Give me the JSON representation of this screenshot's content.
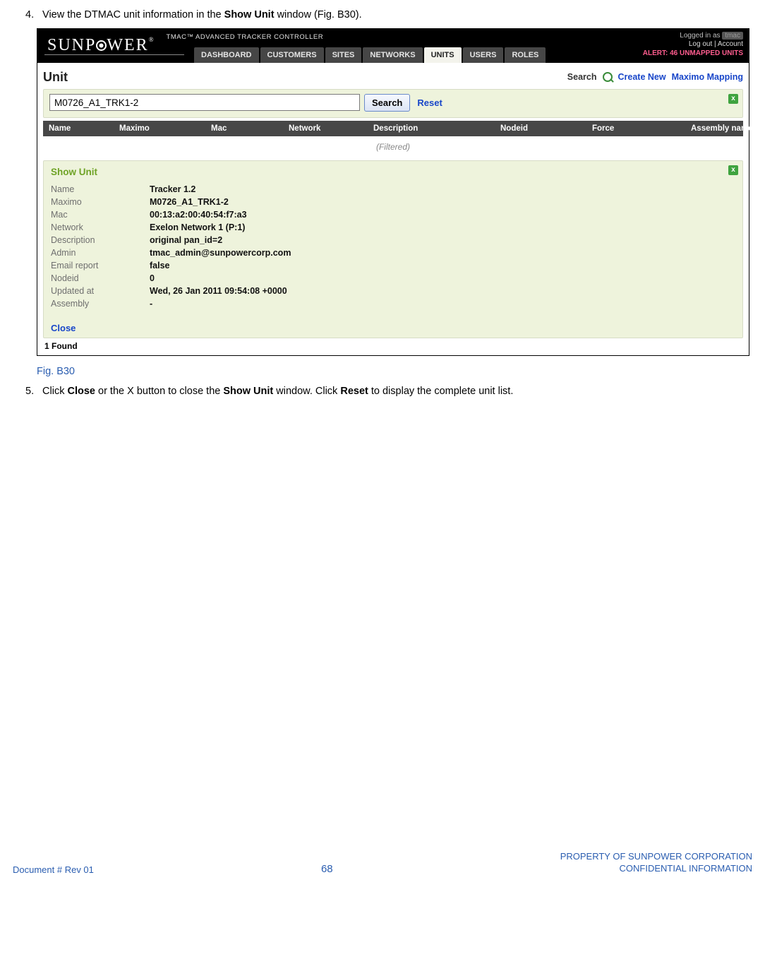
{
  "doc": {
    "step4_num": "4.",
    "step4_a": "View the DTMAC unit information in the ",
    "step4_b": "Show Unit",
    "step4_c": " window (Fig. B30).",
    "fig_caption": "Fig. B30",
    "step5_num": "5.",
    "step5_a": "Click ",
    "step5_b": "Close",
    "step5_c": " or the X button to close the ",
    "step5_d": "Show Unit",
    "step5_e": " window. Click ",
    "step5_f": "Reset",
    "step5_g": " to display the complete unit list."
  },
  "footer": {
    "left": "Document #  Rev 01",
    "center": "68",
    "right1": "PROPERTY OF SUNPOWER CORPORATION",
    "right2": "CONFIDENTIAL INFORMATION"
  },
  "app": {
    "logo_a": "SUNP",
    "logo_b": "WER",
    "tmac_title": "TMAC™ ADVANCED TRACKER CONTROLLER",
    "tabs": [
      "DASHBOARD",
      "CUSTOMERS",
      "SITES",
      "NETWORKS",
      "UNITS",
      "USERS",
      "ROLES"
    ],
    "active_tab": 4,
    "logged_in_as": "Logged in as",
    "username": "tmac",
    "logout": "Log out",
    "account": "Account",
    "alert": "ALERT: 46 UNMAPPED UNITS"
  },
  "unit": {
    "heading": "Unit",
    "search_label": "Search",
    "create_new": "Create New",
    "maximo_mapping": "Maximo Mapping",
    "search_value": "M0726_A1_TRK1-2",
    "search_btn": "Search",
    "reset": "Reset",
    "close_x": "x",
    "columns": [
      "Name",
      "Maximo",
      "Mac",
      "Network",
      "Description",
      "Nodeid",
      "Force",
      "Assembly name"
    ],
    "filtered": "(Filtered)",
    "found": "1 Found"
  },
  "show": {
    "title": "Show Unit",
    "rows": {
      "Name": "Tracker 1.2",
      "Maximo": "M0726_A1_TRK1-2",
      "Mac": "00:13:a2:00:40:54:f7:a3",
      "Network": "Exelon Network 1 (P:1)",
      "Description": "original pan_id=2",
      "Admin": "tmac_admin@sunpowercorp.com",
      "Email report": "false",
      "Nodeid": "0",
      "Updated at": "Wed, 26 Jan 2011 09:54:08 +0000",
      "Assembly": "-"
    },
    "close": "Close"
  }
}
